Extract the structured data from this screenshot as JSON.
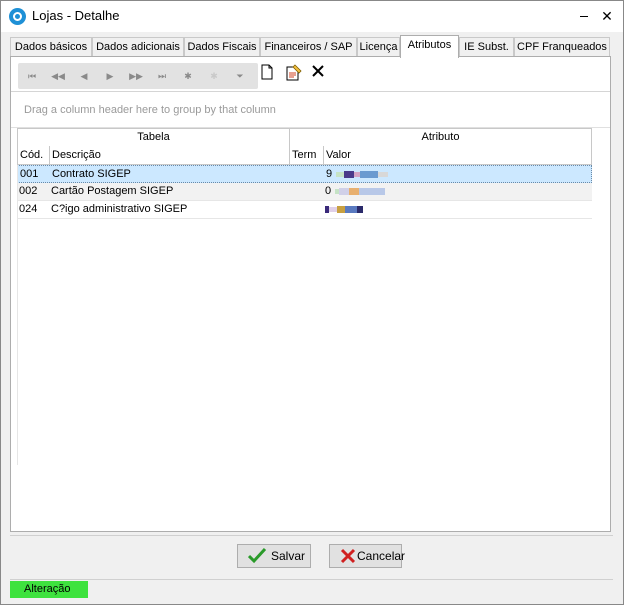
{
  "window": {
    "title": "Lojas - Detalhe",
    "close_glyph": "✕"
  },
  "tabs": [
    {
      "label": "Dados básicos"
    },
    {
      "label": "Dados adicionais"
    },
    {
      "label": "Dados Fiscais"
    },
    {
      "label": "Financeiros / SAP"
    },
    {
      "label": "Licença"
    },
    {
      "label": "Atributos"
    },
    {
      "label": "IE Subst."
    },
    {
      "label": "CPF Franqueados"
    }
  ],
  "active_tab": "Atributos",
  "navigator": {
    "buttons": [
      {
        "name": "first-record",
        "glyph": "⏮"
      },
      {
        "name": "prior-page",
        "glyph": "◀◀"
      },
      {
        "name": "prior-record",
        "glyph": "◀"
      },
      {
        "name": "next-record",
        "glyph": "▶"
      },
      {
        "name": "next-page",
        "glyph": "▶▶"
      },
      {
        "name": "last-record",
        "glyph": "⏭"
      },
      {
        "name": "insert-record",
        "glyph": "✱"
      },
      {
        "name": "append-record",
        "glyph": "✱"
      },
      {
        "name": "filter",
        "glyph": "⏷"
      }
    ]
  },
  "grid": {
    "group_panel_text": "Drag a column header here to group by that column",
    "bands": {
      "tabela": "Tabela",
      "atributo": "Atributo"
    },
    "columns": {
      "cod": "Cód.",
      "descricao": "Descrição",
      "term": "Term",
      "valor": "Valor"
    },
    "rows": [
      {
        "cod": "001",
        "descricao": "Contrato SIGEP",
        "term": "",
        "valor": "9",
        "selected": true
      },
      {
        "cod": "002",
        "descricao": "Cartão Postagem SIGEP",
        "term": "",
        "valor": "0",
        "selected": false
      },
      {
        "cod": "024",
        "descricao": "C?igo administrativo SIGEP",
        "term": "",
        "valor": "",
        "selected": false
      }
    ]
  },
  "buttons": {
    "save": "Salvar",
    "cancel": "Cancelar"
  },
  "status": {
    "mode": "Alteração",
    "color": "#3ee23e"
  },
  "icons": [
    "app-icon",
    "new-document-icon",
    "edit-document-icon",
    "delete-icon",
    "check-icon",
    "cancel-x-icon"
  ]
}
